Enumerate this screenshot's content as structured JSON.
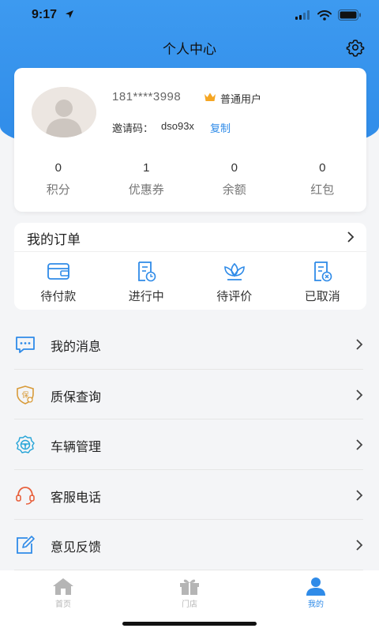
{
  "status_bar": {
    "time": "9:17"
  },
  "nav": {
    "title": "个人中心"
  },
  "profile": {
    "phone": "181****3998",
    "level": "普通用户",
    "invite_label": "邀请码：",
    "invite_code": "dso93x",
    "copy_label": "复制",
    "stats": [
      {
        "value": "0",
        "label": "积分"
      },
      {
        "value": "1",
        "label": "优惠券"
      },
      {
        "value": "0",
        "label": "余额"
      },
      {
        "value": "0",
        "label": "红包"
      }
    ]
  },
  "orders": {
    "title": "我的订单",
    "items": [
      {
        "label": "待付款",
        "icon": "wallet-icon"
      },
      {
        "label": "进行中",
        "icon": "order-progress-icon"
      },
      {
        "label": "待评价",
        "icon": "lotus-review-icon"
      },
      {
        "label": "已取消",
        "icon": "order-cancel-icon"
      }
    ]
  },
  "menu": [
    {
      "label": "我的消息",
      "icon": "message-icon"
    },
    {
      "label": "质保查询",
      "icon": "warranty-shield-icon"
    },
    {
      "label": "车辆管理",
      "icon": "steering-wheel-icon"
    },
    {
      "label": "客服电话",
      "icon": "headset-icon"
    },
    {
      "label": "意见反馈",
      "icon": "edit-feedback-icon"
    }
  ],
  "tabbar": {
    "home": "首页",
    "store": "门店",
    "mine": "我的"
  },
  "colors": {
    "accent": "#2f8be8",
    "crown": "#f5a623",
    "inactive_tab": "#b5b5b5"
  }
}
